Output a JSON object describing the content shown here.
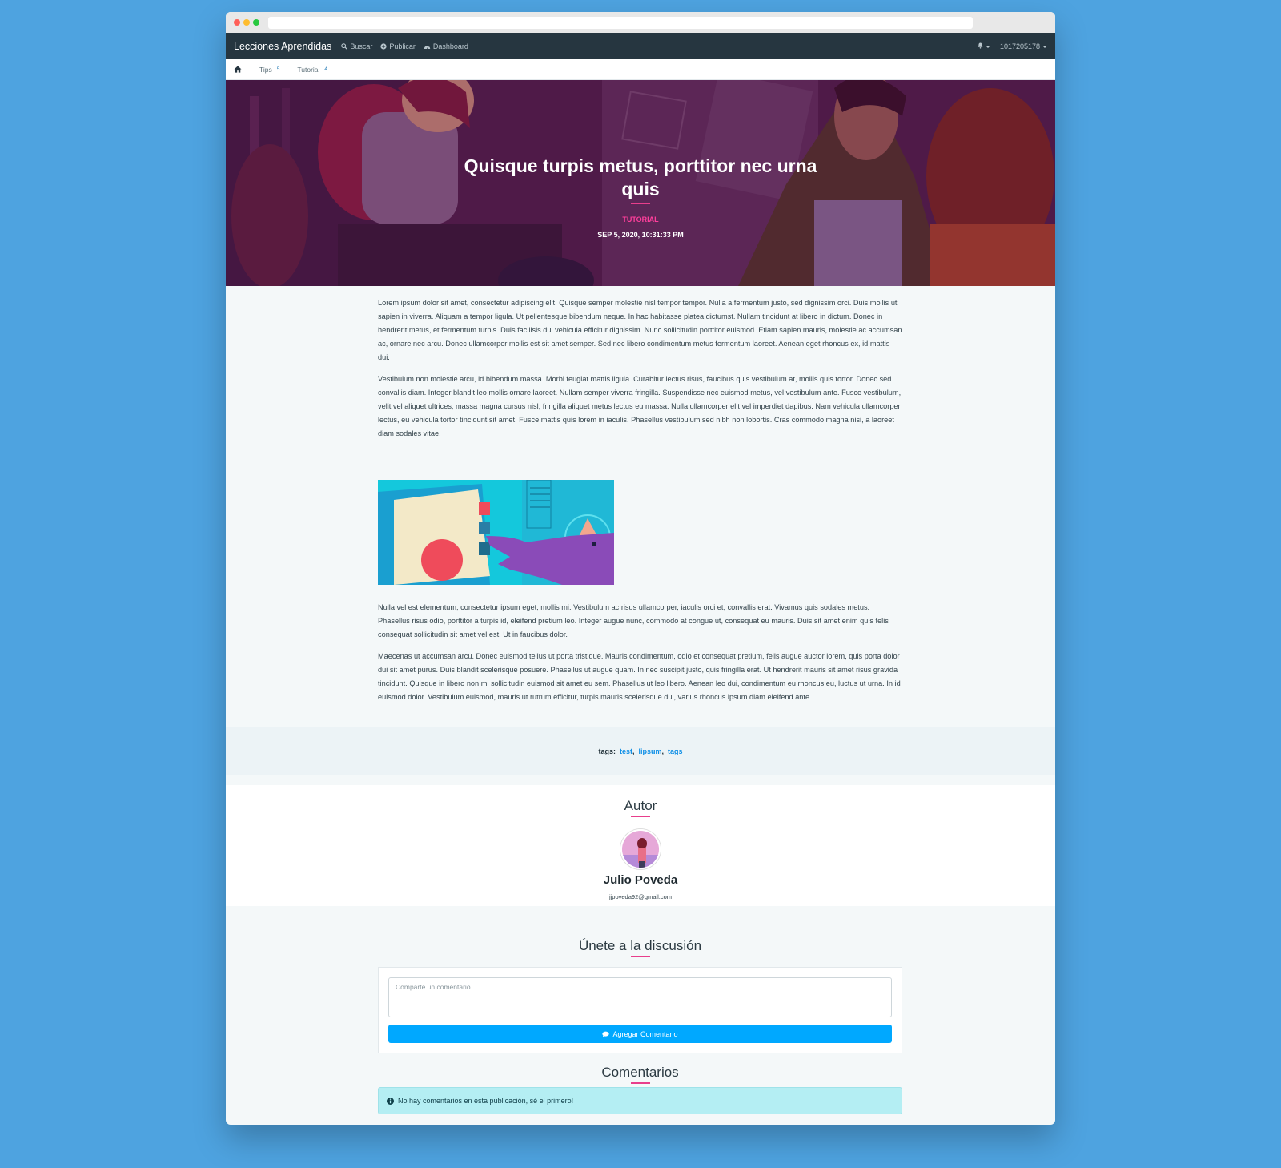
{
  "navbar": {
    "brand": "Lecciones Aprendidas",
    "links": [
      {
        "label": "Buscar",
        "icon": "search-icon"
      },
      {
        "label": "Publicar",
        "icon": "plus-circle-icon"
      },
      {
        "label": "Dashboard",
        "icon": "dashboard-icon"
      }
    ],
    "user": "1017205178"
  },
  "subnav": {
    "items": [
      {
        "label": "Tips",
        "count": "5"
      },
      {
        "label": "Tutorial",
        "count": "4"
      }
    ]
  },
  "post": {
    "title": "Quisque turpis metus, porttitor nec urna quis",
    "category": "TUTORIAL",
    "date": "SEP 5, 2020, 10:31:33 PM",
    "paragraphs_before": [
      "Lorem ipsum dolor sit amet, consectetur adipiscing elit. Quisque semper molestie nisl tempor tempor. Nulla a fermentum justo, sed dignissim orci. Duis mollis ut sapien in viverra. Aliquam a tempor ligula. Ut pellentesque bibendum neque. In hac habitasse platea dictumst. Nullam tincidunt at libero in dictum. Donec in hendrerit metus, et fermentum turpis. Duis facilisis dui vehicula efficitur dignissim. Nunc sollicitudin porttitor euismod. Etiam sapien mauris, molestie ac accumsan ac, ornare nec arcu. Donec ullamcorper mollis est sit amet semper. Sed nec libero condimentum metus fermentum laoreet. Aenean eget rhoncus ex, id mattis dui.",
      "Vestibulum non molestie arcu, id bibendum massa. Morbi feugiat mattis ligula. Curabitur lectus risus, faucibus quis vestibulum at, mollis quis tortor. Donec sed convallis diam. Integer blandit leo mollis ornare laoreet. Nullam semper viverra fringilla. Suspendisse nec euismod metus, vel vestibulum ante. Fusce vestibulum, velit vel aliquet ultrices, massa magna cursus nisl, fringilla aliquet metus lectus eu massa. Nulla ullamcorper elit vel imperdiet dapibus. Nam vehicula ullamcorper lectus, eu vehicula tortor tincidunt sit amet. Fusce mattis quis lorem in iaculis. Phasellus vestibulum sed nibh non lobortis. Cras commodo magna nisi, a laoreet diam sodales vitae."
    ],
    "paragraphs_after": [
      "Nulla vel est elementum, consectetur ipsum eget, mollis mi. Vestibulum ac risus ullamcorper, iaculis orci et, convallis erat. Vivamus quis sodales metus. Phasellus risus odio, porttitor a turpis id, eleifend pretium leo. Integer augue nunc, commodo at congue ut, consequat eu mauris. Duis sit amet enim quis felis consequat sollicitudin sit amet vel est. Ut in faucibus dolor.",
      "Maecenas ut accumsan arcu. Donec euismod tellus ut porta tristique. Mauris condimentum, odio et consequat pretium, felis augue auctor lorem, quis porta dolor dui sit amet purus. Duis blandit scelerisque posuere. Phasellus ut augue quam. In nec suscipit justo, quis fringilla erat. Ut hendrerit mauris sit amet risus gravida tincidunt. Quisque in libero non mi sollicitudin euismod sit amet eu sem. Phasellus ut leo libero. Aenean leo dui, condimentum eu rhoncus eu, luctus ut urna. In id euismod dolor. Vestibulum euismod, mauris ut rutrum efficitur, turpis mauris scelerisque dui, varius rhoncus ipsum diam eleifend ante."
    ],
    "tags_label": "tags:",
    "tags": [
      "test",
      "lipsum",
      "tags"
    ]
  },
  "author": {
    "heading": "Autor",
    "name": "Julio Poveda",
    "email": "jjpoveda92@gmail.com"
  },
  "discussion": {
    "heading": "Únete a la discusión",
    "placeholder": "Comparte un comentario...",
    "button_label": "Agregar Comentario"
  },
  "comments": {
    "heading": "Comentarios",
    "empty_message": "No hay comentarios en esta publicación, sé el primero!"
  },
  "colors": {
    "accent": "#e83e8c",
    "primary_button": "#00a8ff",
    "navbar": "#263640",
    "page_background": "#4ea3e0"
  }
}
